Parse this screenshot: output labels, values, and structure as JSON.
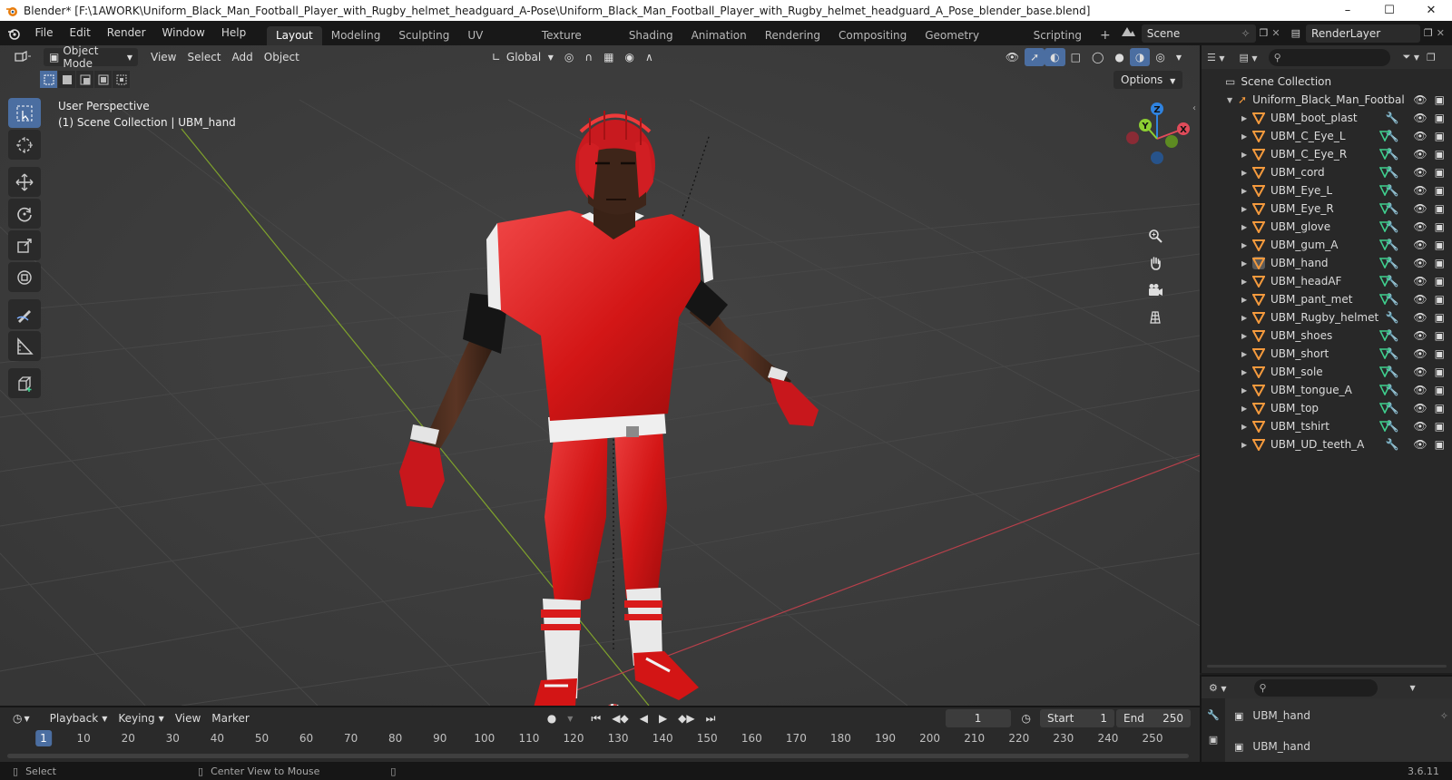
{
  "window": {
    "title": "Blender* [F:\\1AWORK\\Uniform_Black_Man_Football_Player_with_Rugby_helmet_headguard_A-Pose\\Uniform_Black_Man_Football_Player_with_Rugby_helmet_headguard_A_Pose_blender_base.blend]",
    "minimize": "–",
    "maximize": "☐",
    "close": "✕"
  },
  "menu": [
    "File",
    "Edit",
    "Render",
    "Window",
    "Help"
  ],
  "workspaces": [
    "Layout",
    "Modeling",
    "Sculpting",
    "UV Editing",
    "Texture Paint",
    "Shading",
    "Animation",
    "Rendering",
    "Compositing",
    "Geometry Nodes",
    "Scripting"
  ],
  "active_workspace": "Layout",
  "add_workspace": "+",
  "scene": "Scene",
  "render_layer": "RenderLayer",
  "viewport": {
    "mode": "Object Mode",
    "menus": [
      "View",
      "Select",
      "Add",
      "Object"
    ],
    "transform_orientation": "Global",
    "options_label": "Options",
    "perspective": "User Perspective",
    "collection_info": "(1) Scene Collection | UBM_hand",
    "axes": {
      "x": "X",
      "y": "Y",
      "z": "Z"
    }
  },
  "outliner": {
    "root": "Scene Collection",
    "collection": "Uniform_Black_Man_Footbal",
    "objects": [
      {
        "name": "UBM_boot_plast",
        "mesh": false
      },
      {
        "name": "UBM_C_Eye_L",
        "mesh": true
      },
      {
        "name": "UBM_C_Eye_R",
        "mesh": true
      },
      {
        "name": "UBM_cord",
        "mesh": true
      },
      {
        "name": "UBM_Eye_L",
        "mesh": true
      },
      {
        "name": "UBM_Eye_R",
        "mesh": true
      },
      {
        "name": "UBM_glove",
        "mesh": true
      },
      {
        "name": "UBM_gum_A",
        "mesh": true
      },
      {
        "name": "UBM_hand",
        "mesh": true,
        "active": true
      },
      {
        "name": "UBM_headAF",
        "mesh": true
      },
      {
        "name": "UBM_pant_met",
        "mesh": true
      },
      {
        "name": "UBM_Rugby_helmet",
        "mesh": false,
        "no_mods": true
      },
      {
        "name": "UBM_shoes",
        "mesh": true
      },
      {
        "name": "UBM_short",
        "mesh": true
      },
      {
        "name": "UBM_sole",
        "mesh": true
      },
      {
        "name": "UBM_tongue_A",
        "mesh": true
      },
      {
        "name": "UBM_top",
        "mesh": true
      },
      {
        "name": "UBM_tshirt",
        "mesh": true
      },
      {
        "name": "UBM_UD_teeth_A",
        "mesh": false
      }
    ]
  },
  "properties": {
    "object_name": "UBM_hand",
    "data_name": "UBM_hand"
  },
  "timeline": {
    "menus": [
      "Playback",
      "Keying",
      "View",
      "Marker"
    ],
    "current_frame": "1",
    "start_label": "Start",
    "start": "1",
    "end_label": "End",
    "end": "250",
    "ticks": [
      "1",
      "10",
      "20",
      "30",
      "40",
      "50",
      "60",
      "70",
      "80",
      "90",
      "100",
      "110",
      "120",
      "130",
      "140",
      "150",
      "160",
      "170",
      "180",
      "190",
      "200",
      "210",
      "220",
      "230",
      "240",
      "250"
    ]
  },
  "status": {
    "select": "Select",
    "center_view": "Center View to Mouse",
    "version": "3.6.11"
  },
  "colors": {
    "accent": "#4b6ea1",
    "mesh_icon": "#f59a3d",
    "modifier_icon": "#6fa8ff",
    "mesh_data_icon": "#3fcf8e",
    "uniform_red": "#d61a1a",
    "x_axis": "#e04b5a",
    "y_axis": "#8ccf32",
    "z_axis": "#2f83e0"
  }
}
